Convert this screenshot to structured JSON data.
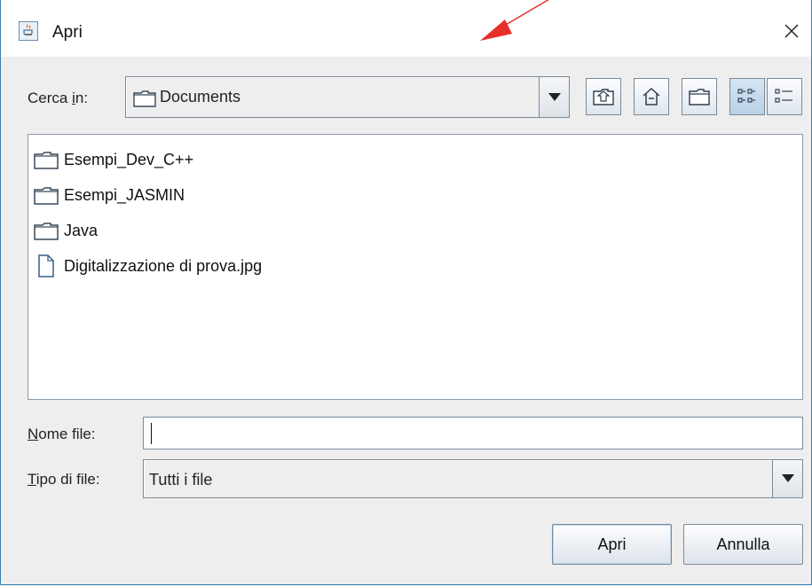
{
  "window": {
    "title": "Apri",
    "close_glyph": "✕"
  },
  "look_in": {
    "label_prefix": "Cerca ",
    "label_mnemonic": "i",
    "label_suffix": "n:",
    "value": "Documents"
  },
  "toolbar": {
    "icons": [
      "up-folder-icon",
      "home-icon",
      "new-folder-icon",
      "list-view-icon",
      "details-view-icon"
    ]
  },
  "files": [
    {
      "name": "Esempi_Dev_C++",
      "type": "folder"
    },
    {
      "name": "Esempi_JASMIN",
      "type": "folder"
    },
    {
      "name": "Java",
      "type": "folder"
    },
    {
      "name": "Digitalizzazione di prova.jpg",
      "type": "file"
    }
  ],
  "file_name": {
    "label_mnemonic": "N",
    "label_rest": "ome file:",
    "value": ""
  },
  "file_type": {
    "label_mnemonic": "T",
    "label_rest": "ipo di file:",
    "value": "Tutti i file"
  },
  "buttons": {
    "open": "Apri",
    "cancel": "Annulla"
  },
  "colors": {
    "annotation_arrow": "#e8302a",
    "window_border": "#3c7fb1"
  }
}
